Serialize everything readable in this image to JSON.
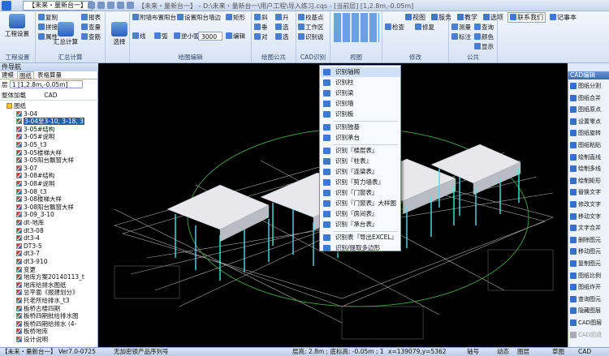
{
  "titlebar": {
    "qa_tab": "【未来・量新台一】",
    "title": "【未来・量新台一】 - D:\\未来・量新台一\\用户工程\\导入练习.cqs - [当前层] [1,2.8m,-0.05m]"
  },
  "menu_right": [
    {
      "label": "视图"
    },
    {
      "label": "服务"
    },
    {
      "label": "教学"
    },
    {
      "label": "选项"
    },
    {
      "label": "联系我们",
      "highlight": true
    },
    {
      "label": "记事本"
    }
  ],
  "ribbon": {
    "groups": [
      {
        "label": "工程设置",
        "buttons": [
          "工程设置"
        ]
      },
      {
        "label": "汇总计算",
        "buttons": [
          "汇总计算",
          "复制",
          "拼接",
          "属性",
          "报表",
          "查量",
          "查筋"
        ]
      },
      {
        "label": "选择"
      },
      {
        "label": "绘图编辑",
        "buttons": [
          "附墙布置阳台",
          "设置阳台墙边",
          "矩形",
          "线",
          "弧",
          "逆小弧",
          "编辑"
        ],
        "spin_value": "3000"
      },
      {
        "label": "绘图公共",
        "buttons": [
          "斜",
          "垂",
          "升",
          "选",
          "对",
          "选"
        ]
      },
      {
        "label": "CAD识别",
        "buttons": [
          "校基点",
          "工作区",
          "识别说"
        ]
      },
      {
        "label": "视图"
      },
      {
        "label": "修改",
        "buttons": [
          "检查",
          "修复"
        ]
      },
      {
        "label": "公共",
        "buttons": [
          "测量",
          "查询",
          "标注",
          "颜色",
          "显示"
        ]
      }
    ]
  },
  "left_panel": {
    "title": "件导航",
    "tabs": [
      "建模",
      "图纸",
      "表格算量"
    ],
    "active_tab": "图纸",
    "floor_label": "层",
    "floor_value": "1 [1,2.8m,-0.05m]",
    "tools": [
      "整体加载",
      "CAD"
    ],
    "tree": [
      {
        "label": "图纸",
        "type": "folder"
      },
      {
        "label": "3-04"
      },
      {
        "label": "3-04至3-10, 3-18, 3",
        "selected": true
      },
      {
        "label": "3-05#结构"
      },
      {
        "label": "3-05#说明"
      },
      {
        "label": "3-05_t3"
      },
      {
        "label": "3-05楼梯大样"
      },
      {
        "label": "3-05阳台飘窗大样"
      },
      {
        "label": "3-07"
      },
      {
        "label": "3-08#结构"
      },
      {
        "label": "3-08#说明"
      },
      {
        "label": "3-08_t3"
      },
      {
        "label": "3-08楼梯大样"
      },
      {
        "label": "3-08阳台飘窗大样"
      },
      {
        "label": "3-09_3-10"
      },
      {
        "label": "dt-地库"
      },
      {
        "label": "dt3-08"
      },
      {
        "label": "dt3-4"
      },
      {
        "label": "DT3-5"
      },
      {
        "label": "dt3-7"
      },
      {
        "label": "dt3-910"
      },
      {
        "label": "变更"
      },
      {
        "label": "地库方案20140113_t"
      },
      {
        "label": "地库给排水图纸"
      },
      {
        "label": "总平面《报建划分》"
      },
      {
        "label": "托老所给排水_t3"
      },
      {
        "label": "板桥古楼四期"
      },
      {
        "label": "板桥四期批给排水图"
      },
      {
        "label": "板桥四期给排水 (4-"
      },
      {
        "label": "板桥地库"
      },
      {
        "label": "设计说明"
      }
    ]
  },
  "context_menu": [
    "识别轴网",
    "识别柱",
    "识别梁",
    "识别墙",
    "识别板",
    "识别独基",
    "识别承台",
    "识别『楼层表』",
    "识别『柱表』",
    "识别『连梁表』",
    "识别『剪力墙表』",
    "识别『门窗表』",
    "识别『门窗表』大样图",
    "识别『房间表』",
    "识别『承台表』",
    "识别表『导出EXCEL』",
    "识别/提取多边形"
  ],
  "right_panel": {
    "title": "CAD编辑",
    "items": [
      {
        "label": "图纸分割"
      },
      {
        "label": "图纸合并"
      },
      {
        "label": "图纸原点"
      },
      {
        "label": "设置零点"
      },
      {
        "label": "图纸旋转"
      },
      {
        "label": "图纸粘贴"
      },
      {
        "label": "绘制直线"
      },
      {
        "label": "绘制多线"
      },
      {
        "label": "绘制矩形"
      },
      {
        "label": "替换文字"
      },
      {
        "label": "修改文字"
      },
      {
        "label": "移动文字"
      },
      {
        "label": "文字合并"
      },
      {
        "label": "删除图元"
      },
      {
        "label": "移动图元"
      },
      {
        "label": "复制图元"
      },
      {
        "label": "图纸比例"
      },
      {
        "label": "图纸炸开"
      },
      {
        "label": "查询图元"
      },
      {
        "label": "隐藏图层"
      },
      {
        "label": "CAD图层"
      },
      {
        "label": "CAD回退",
        "disabled": true
      }
    ]
  },
  "statusbar": {
    "app": "【未来・量新台一】 Ver7.0-0725",
    "license": "无加密锁产品序列号",
    "floor": "层高: 2.8m ; 底标高: -0.05m ; 1",
    "coords": "x=139079,y=5362",
    "snap": "轴号",
    "dynamic": "动态",
    "layer": "图层",
    "sketch": "草图",
    "cad": "CAD"
  },
  "colors": {
    "canvas_bg": "#000000",
    "ribbon_bg": "#dfe8f6",
    "selection": "#2a5db0"
  }
}
